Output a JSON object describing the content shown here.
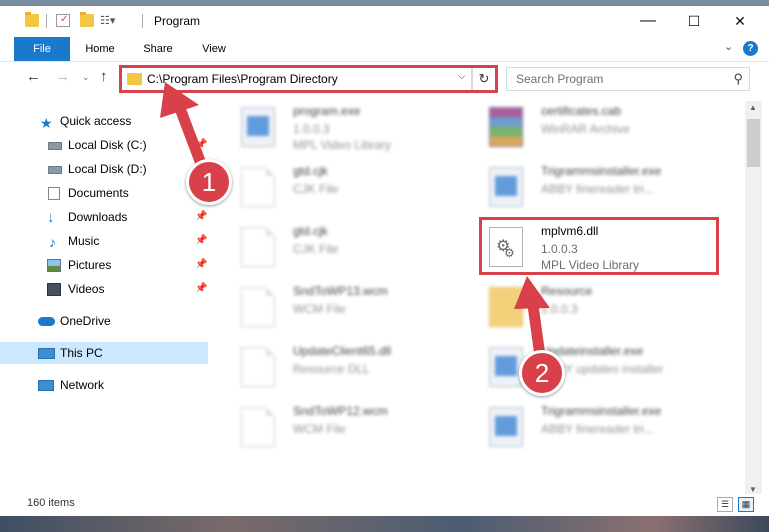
{
  "window": {
    "title": "Program",
    "controls": {
      "minimize": "—",
      "maximize": "☐",
      "close": "✕"
    }
  },
  "ribbon": {
    "tabs": [
      "File",
      "Home",
      "Share",
      "View"
    ],
    "help": "?"
  },
  "navbar": {
    "address_path": "C:\\Program Files\\Program Directory",
    "search_placeholder": "Search Program"
  },
  "nav_pane": {
    "items": [
      {
        "label": "Quick access",
        "icon": "star-icon"
      },
      {
        "label": "Local Disk (C:)",
        "icon": "drive-icon",
        "pinned": true
      },
      {
        "label": "Local Disk (D:)",
        "icon": "drive-icon",
        "pinned": true
      },
      {
        "label": "Documents",
        "icon": "documents-icon",
        "pinned": true
      },
      {
        "label": "Downloads",
        "icon": "download-icon",
        "pinned": true
      },
      {
        "label": "Music",
        "icon": "music-icon",
        "pinned": true
      },
      {
        "label": "Pictures",
        "icon": "pictures-icon",
        "pinned": true
      },
      {
        "label": "Videos",
        "icon": "videos-icon",
        "pinned": true
      },
      {
        "label": "OneDrive",
        "icon": "cloud-icon"
      },
      {
        "label": "This PC",
        "icon": "computer-icon",
        "selected": true
      },
      {
        "label": "Network",
        "icon": "network-icon"
      }
    ]
  },
  "files": [
    {
      "name": "program.exe",
      "line2": "1.0.0.3",
      "line3": "MPL Video Library",
      "icon": "exe-icon",
      "blurred": true
    },
    {
      "name": "certificates.cab",
      "line2": "WinRAR Archive",
      "line3": "",
      "icon": "archive-icon",
      "blurred": true
    },
    {
      "name": "gtd.cjk",
      "line2": "CJK File",
      "line3": "",
      "icon": "document-icon",
      "blurred": true
    },
    {
      "name": "Trigrammsinstaller.exe",
      "line2": "ABBY finereader tri...",
      "line3": "",
      "icon": "exe-icon",
      "blurred": true
    },
    {
      "name": "gtd.cjk",
      "line2": "CJK File",
      "line3": "",
      "icon": "document-icon",
      "blurred": true
    },
    {
      "name": "mplvm6.dll",
      "line2": "1.0.0.3",
      "line3": "MPL Video Library",
      "icon": "dll-icon",
      "blurred": false
    },
    {
      "name": "SndToWP13.wcm",
      "line2": "WCM File",
      "line3": "",
      "icon": "document-icon",
      "blurred": true
    },
    {
      "name": "Resource",
      "line2": "1.0.0.3",
      "line3": "",
      "icon": "folder-icon",
      "blurred": true
    },
    {
      "name": "UpdateClient65.dll",
      "line2": "Resource DLL",
      "line3": "",
      "icon": "dll-icon",
      "blurred": true
    },
    {
      "name": "Updateinstaller.exe",
      "line2": "ABBY updates installer",
      "line3": "",
      "icon": "exe-icon",
      "blurred": true
    },
    {
      "name": "SndToWP12.wcm",
      "line2": "WCM File",
      "line3": "",
      "icon": "document-icon",
      "blurred": true
    },
    {
      "name": "Trigrammsinstaller.exe",
      "line2": "ABBY finereader tri...",
      "line3": "",
      "icon": "exe-icon",
      "blurred": true
    }
  ],
  "status": {
    "item_count": "160 items"
  },
  "annotations": {
    "step1": "1",
    "step2": "2",
    "color": "#d9414a"
  },
  "colors": {
    "accent": "#1979ca",
    "selection": "#cce8ff"
  }
}
